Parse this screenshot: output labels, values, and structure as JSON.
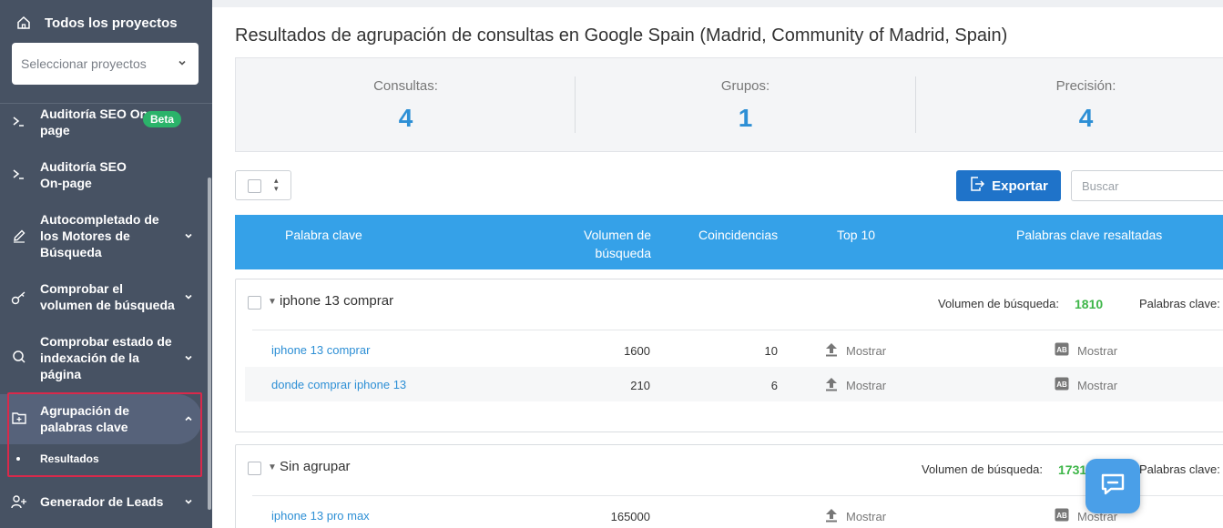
{
  "sidebar": {
    "all_projects": "Todos los proyectos",
    "select_placeholder": "Seleccionar proyectos",
    "items": [
      {
        "label": "Auditoría SEO On-page",
        "badge": "Beta"
      },
      {
        "label": "Auditoría SEO On-page"
      },
      {
        "label": "Autocompletado de los Motores de Búsqueda"
      },
      {
        "label": "Comprobar el volumen de búsqueda"
      },
      {
        "label": "Comprobar estado de indexación de la página"
      },
      {
        "label": "Agrupación de palabras clave"
      },
      {
        "label": "Generador de Leads"
      }
    ],
    "sub_item": "Resultados"
  },
  "main": {
    "title": "Resultados de agrupación de consultas en Google Spain (Madrid, Community of Madrid, Spain)",
    "stats": [
      {
        "label": "Consultas:",
        "value": "4"
      },
      {
        "label": "Grupos:",
        "value": "1"
      },
      {
        "label": "Precisión:",
        "value": "4"
      }
    ],
    "export_label": "Exportar",
    "search_placeholder": "Buscar",
    "columns": {
      "keyword": "Palabra clave",
      "volume": "Volumen de búsqueda",
      "matches": "Coincidencias",
      "top10": "Top 10",
      "highlighted": "Palabras clave resaltadas"
    },
    "show_label": "Mostrar",
    "groups": [
      {
        "name": "iphone 13 comprar",
        "volume_label": "Volumen de búsqueda:",
        "volume": "1810",
        "keywords_label": "Palabras clave:",
        "rows": [
          {
            "keyword": "iphone 13 comprar",
            "volume": "1600",
            "matches": "10"
          },
          {
            "keyword": "donde comprar iphone 13",
            "volume": "210",
            "matches": "6"
          }
        ]
      },
      {
        "name": "Sin agrupar",
        "volume_label": "Volumen de búsqueda:",
        "volume": "1731",
        "keywords_label": "Palabras clave:",
        "rows": [
          {
            "keyword": "iphone 13 pro max",
            "volume": "165000",
            "matches": ""
          }
        ]
      }
    ]
  },
  "colors": {
    "sidebar_bg": "#475263",
    "accent_blue": "#2d8fd5",
    "header_blue": "#35a1e8",
    "export_blue": "#1f73c9",
    "green": "#3eb649",
    "highlight_border": "#d9294b"
  }
}
